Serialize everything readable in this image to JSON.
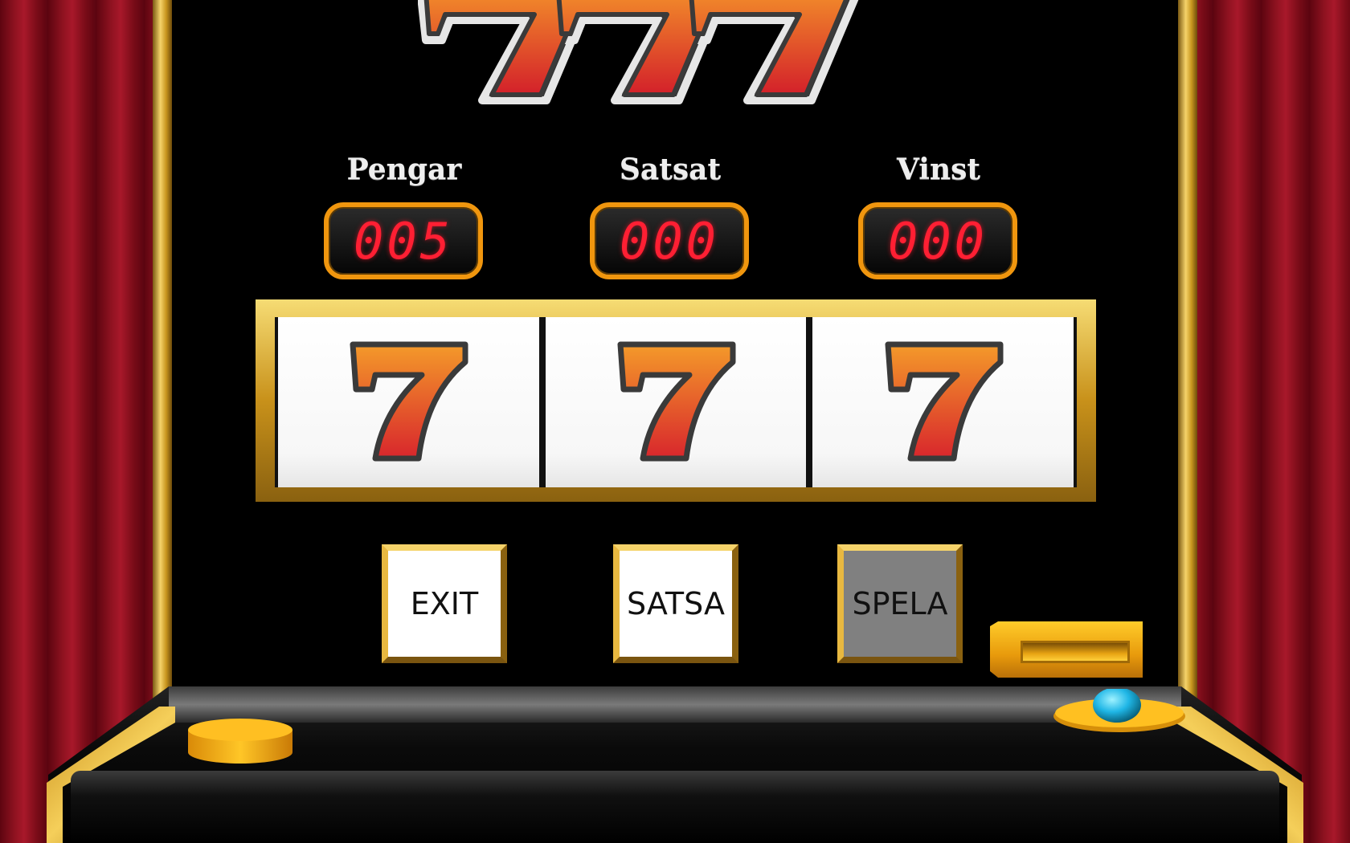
{
  "counters": [
    {
      "label": "Pengar",
      "value": "005"
    },
    {
      "label": "Satsat",
      "value": "000"
    },
    {
      "label": "Vinst",
      "value": "000"
    }
  ],
  "reels": [
    "7",
    "7",
    "7"
  ],
  "buttons": {
    "exit": "EXIT",
    "satsa": "SATSA",
    "spela": "SPELA"
  },
  "colors": {
    "counter_digits": "#ff1f33",
    "counter_border": "#f0960e",
    "gold": "#c8951e",
    "curtain": "#8e1220",
    "spela_button_bg": "#808080"
  },
  "icons": {
    "logo": "triple-seven-logo-icon",
    "reel_symbol": "seven-icon",
    "coin": "coin-icon",
    "lever_knob": "lever-knob-icon"
  }
}
